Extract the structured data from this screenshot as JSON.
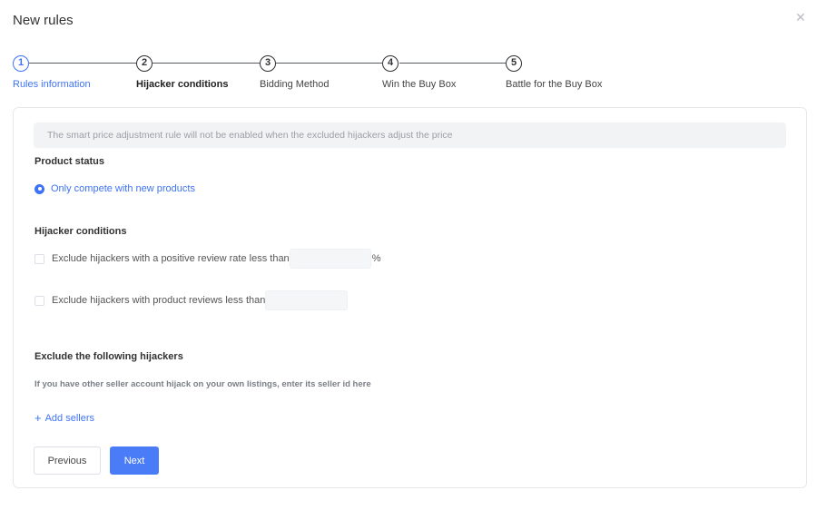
{
  "modal": {
    "title": "New rules",
    "close_icon": "close-icon"
  },
  "steps": [
    {
      "number": "1",
      "label": "Rules information",
      "state": "active"
    },
    {
      "number": "2",
      "label": "Hijacker conditions",
      "state": "current"
    },
    {
      "number": "3",
      "label": "Bidding Method",
      "state": "pending"
    },
    {
      "number": "4",
      "label": "Win the Buy Box",
      "state": "pending"
    },
    {
      "number": "5",
      "label": "Battle for the Buy Box",
      "state": "pending"
    }
  ],
  "notice": "The smart price adjustment rule will not be enabled when the excluded hijackers adjust the price",
  "product_status": {
    "title": "Product status",
    "option_label": "Only compete with new products",
    "selected": true
  },
  "hijacker_conditions": {
    "title": "Hijacker conditions",
    "review_rate": {
      "label": "Exclude hijackers with a positive review rate less than",
      "value": "",
      "unit": "%",
      "checked": false
    },
    "review_count": {
      "label": "Exclude hijackers with product reviews less than",
      "value": "",
      "checked": false
    }
  },
  "exclude_sellers": {
    "title": "Exclude the following hijackers",
    "hint": "If you have other seller account hijack on your own listings, enter its seller id here",
    "add_label": "Add sellers"
  },
  "buttons": {
    "previous": "Previous",
    "next": "Next"
  },
  "colors": {
    "accent": "#3f73f6",
    "primary_button": "#4a7cf7"
  }
}
